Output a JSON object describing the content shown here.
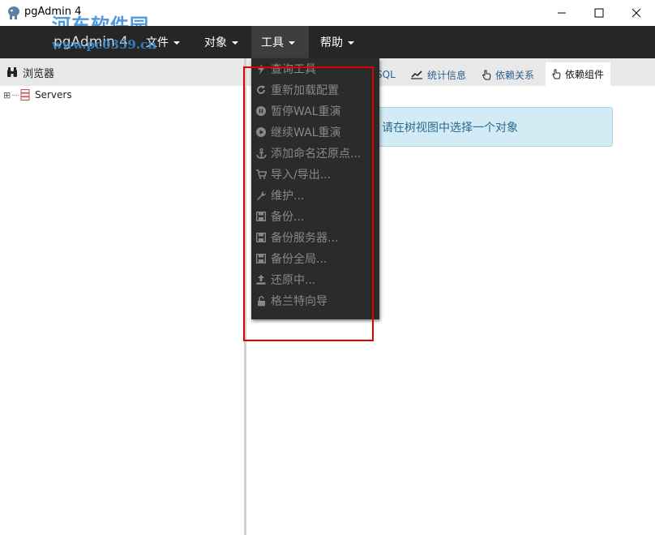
{
  "window": {
    "title": "pgAdmin 4",
    "watermark": "河东软件园",
    "watermark_url": "www.pc0359.cn",
    "minimize_label": "—",
    "maximize_label": "☐",
    "close_label": "✕"
  },
  "menubar": {
    "brand": "pgAdmin 4",
    "menus": [
      {
        "label": "文件"
      },
      {
        "label": "对象"
      },
      {
        "label": "工具"
      },
      {
        "label": "帮助"
      }
    ]
  },
  "browser": {
    "title": "浏览器",
    "tree": [
      {
        "expander": "⊞",
        "label": "Servers"
      }
    ]
  },
  "tabs": [
    {
      "label": "SQL"
    },
    {
      "label": "统计信息"
    },
    {
      "label": "依赖关系"
    },
    {
      "label": "依赖组件"
    }
  ],
  "alert": {
    "text": "请在树视图中选择一个对象"
  },
  "tools_menu": {
    "items": [
      {
        "icon": "bolt-icon",
        "label": "查询工具"
      },
      {
        "icon": "refresh-icon",
        "label": "重新加载配置"
      },
      {
        "icon": "pause-circle-icon",
        "label": "暂停WAL重演"
      },
      {
        "icon": "play-circle-icon",
        "label": "继续WAL重演"
      },
      {
        "icon": "anchor-icon",
        "label": "添加命名还原点..."
      },
      {
        "icon": "cart-icon",
        "label": "导入/导出..."
      },
      {
        "icon": "wrench-icon",
        "label": "维护..."
      },
      {
        "icon": "floppy-icon",
        "label": "备份..."
      },
      {
        "icon": "floppy-icon",
        "label": "备份服务器..."
      },
      {
        "icon": "floppy-icon",
        "label": "备份全局..."
      },
      {
        "icon": "upload-icon",
        "label": "还原中..."
      },
      {
        "icon": "unlock-icon",
        "label": "格兰特向导"
      }
    ]
  },
  "colors": {
    "menubar_bg": "#262626",
    "dropdown_bg": "#2b2b2b",
    "disabled_text": "#888888",
    "highlight_box": "#e00000",
    "alert_bg": "#d3ebf5"
  }
}
